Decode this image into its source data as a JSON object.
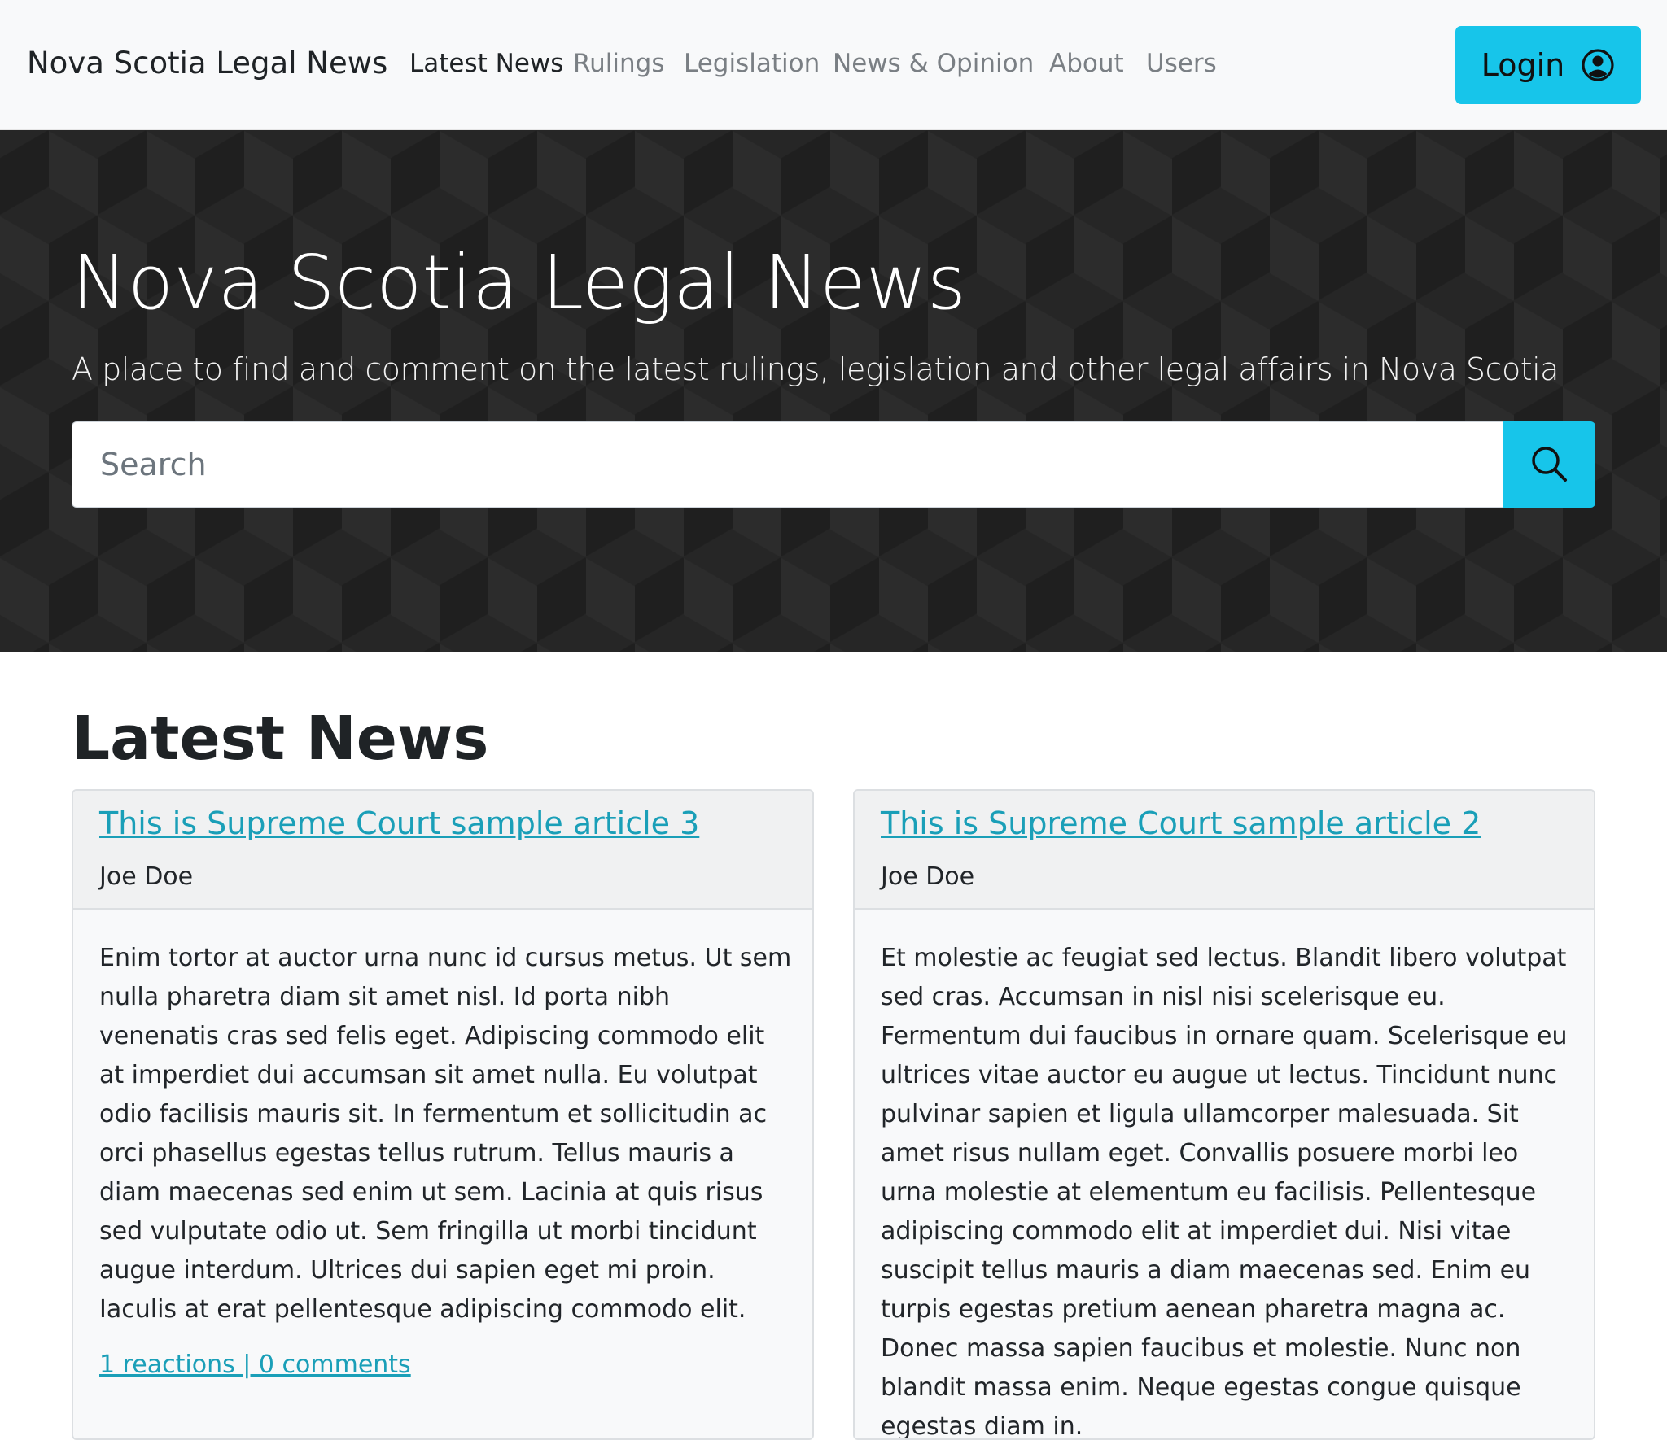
{
  "navbar": {
    "brand": "Nova Scotia Legal News",
    "items": [
      {
        "label": "Latest News",
        "active": true
      },
      {
        "label": "Rulings",
        "active": false
      },
      {
        "label": "Legislation",
        "active": false
      },
      {
        "label": "News & Opinion",
        "active": false
      },
      {
        "label": "About",
        "active": false
      },
      {
        "label": "Users",
        "active": false
      }
    ],
    "login_label": "Login",
    "login_icon": "user-circle-icon"
  },
  "hero": {
    "title": "Nova Scotia Legal News",
    "subtitle": "A place to find and comment on the latest rulings, legislation and other legal affairs in Nova Scotia",
    "search": {
      "placeholder": "Search",
      "value": "",
      "button_icon": "search-icon"
    }
  },
  "colors": {
    "accent": "#17c5ea",
    "link": "#1a9fb8",
    "hero_bg": "#1f1f1f"
  },
  "latest_news": {
    "title": "Latest News",
    "articles": [
      {
        "title": "This is Supreme Court sample article 3",
        "author": "Joe Doe",
        "body": "Enim tortor at auctor urna nunc id cursus metus. Ut sem nulla pharetra diam sit amet nisl. Id porta nibh venenatis cras sed felis eget. Adipiscing commodo elit at imperdiet dui accumsan sit amet nulla. Eu volutpat odio facilisis mauris sit. In fermentum et sollicitudin ac orci phasellus egestas tellus rutrum. Tellus mauris a diam maecenas sed enim ut sem. Lacinia at quis risus sed vulputate odio ut. Sem fringilla ut morbi tincidunt augue interdum. Ultrices dui sapien eget mi proin. Iaculis at erat pellentesque adipiscing commodo elit.",
        "footer": "1 reactions | 0 comments"
      },
      {
        "title": "This is Supreme Court sample article 2",
        "author": "Joe Doe",
        "body": "Et molestie ac feugiat sed lectus. Blandit libero volutpat sed cras. Accumsan in nisl nisi scelerisque eu. Fermentum dui faucibus in ornare quam. Scelerisque eu ultrices vitae auctor eu augue ut lectus. Tincidunt nunc pulvinar sapien et ligula ullamcorper malesuada. Sit amet risus nullam eget. Convallis posuere morbi leo urna molestie at elementum eu facilisis. Pellentesque adipiscing commodo elit at imperdiet dui. Nisi vitae suscipit tellus mauris a diam maecenas sed. Enim eu turpis egestas pretium aenean pharetra magna ac. Donec massa sapien faucibus et molestie. Nunc non blandit massa enim. Neque egestas congue quisque egestas diam in."
      }
    ]
  }
}
